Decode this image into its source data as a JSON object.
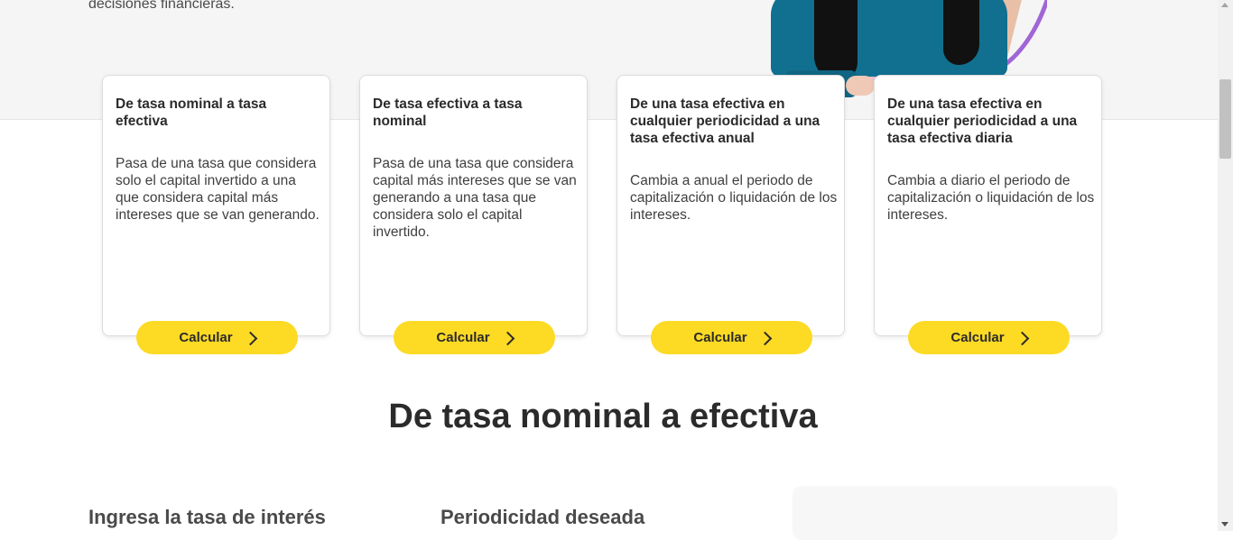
{
  "hero": {
    "text": "decisiones financieras."
  },
  "cards": [
    {
      "title": "De tasa nominal a tasa efectiva",
      "description": "Pasa de una tasa que considera solo el capital invertido a una que considera capital más intereses que se van generando.",
      "button_label": "Calcular",
      "button_icon": "chevron-right-icon"
    },
    {
      "title": "De tasa efectiva a tasa nominal",
      "description": "Pasa de una tasa que considera capital más intereses que se van generando a una tasa que considera solo el capital invertido.",
      "button_label": "Calcular",
      "button_icon": "chevron-right-icon"
    },
    {
      "title": "De una tasa efectiva en cualquier periodicidad a una tasa efectiva anual",
      "description": "Cambia a anual el periodo de capitalización o liquidación de los intereses.",
      "button_label": "Calcular",
      "button_icon": "chevron-right-icon"
    },
    {
      "title": "De una tasa efectiva en cualquier periodicidad a una tasa efectiva diaria",
      "description": "Cambia a diario el periodo de capitalización o liquidación de los intereses.",
      "button_label": "Calcular",
      "button_icon": "chevron-right-icon"
    }
  ],
  "section": {
    "title": "De tasa nominal a efectiva",
    "rate_label": "Ingresa la tasa de interés",
    "period_label": "Periodicidad deseada"
  },
  "colors": {
    "accent": "#fdda24",
    "hero_background": "#f5f5f5",
    "text": "#2b2b2b"
  }
}
